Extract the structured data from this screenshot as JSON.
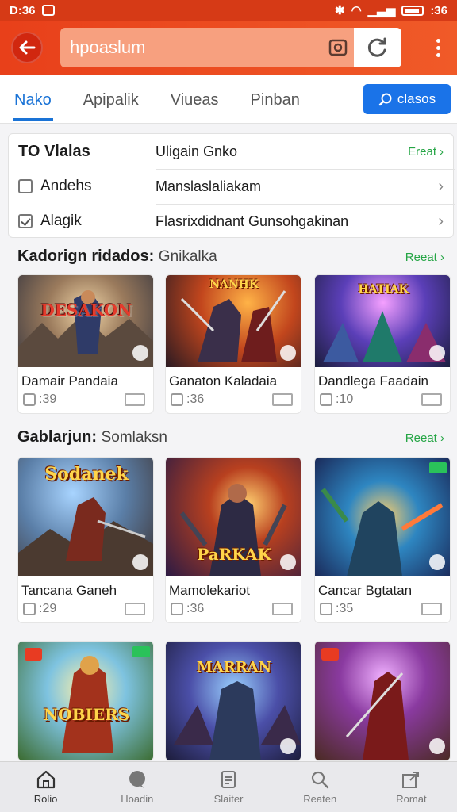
{
  "status": {
    "time": "D:36",
    "right_time": ":36"
  },
  "search": {
    "placeholder": "hpoaslum"
  },
  "tabs": [
    {
      "label": "Nako",
      "active": true
    },
    {
      "label": "Apipalik"
    },
    {
      "label": "Viueas"
    },
    {
      "label": "Pinban"
    }
  ],
  "tab_action": {
    "label": "clasos"
  },
  "filters": {
    "title": "TO Vlalas",
    "header_value": "Uligain Gnko",
    "header_link": "Ereat",
    "rows": [
      {
        "label": "Andehs",
        "value": "Manslaslaliakam",
        "checked": false
      },
      {
        "label": "Alagik",
        "value": "Flasrixdidnant Gunsohgakinan",
        "checked": true
      }
    ]
  },
  "section1": {
    "title": "Kadorign ridados:",
    "subtitle": "Gnikalka",
    "see_all": "Reeat",
    "cards": [
      {
        "name": "Damair Pandaia",
        "rating": ":39",
        "art_title": "DESAKON"
      },
      {
        "name": "Ganaton Kaladaia",
        "rating": ":36",
        "art_title": "NANHK"
      },
      {
        "name": "Dandlega Faadain",
        "rating": ":10",
        "art_title": "HATIAK"
      }
    ]
  },
  "section2": {
    "title": "Gablarjun:",
    "subtitle": "Somlaksn",
    "see_all": "Reeat",
    "cards": [
      {
        "name": "Tancana Ganeh",
        "rating": ":29",
        "art_title": "Sodanek"
      },
      {
        "name": "Mamolekariot",
        "rating": ":36",
        "art_title": "PaRKAK"
      },
      {
        "name": "Cancar Bgtatan",
        "rating": ":35",
        "art_title": ""
      }
    ]
  },
  "section3": {
    "cards": [
      {
        "art_title": "NOBIERS"
      },
      {
        "art_title": "MARRAN"
      },
      {
        "art_title": ""
      }
    ]
  },
  "bottom_nav": [
    {
      "label": "Rolio",
      "icon": "home-icon",
      "active": true
    },
    {
      "label": "Hoadin",
      "icon": "chat-icon"
    },
    {
      "label": "Slaiter",
      "icon": "list-icon"
    },
    {
      "label": "Reaten",
      "icon": "search-icon"
    },
    {
      "label": "Romat",
      "icon": "share-icon"
    }
  ],
  "colors": {
    "brand": "#e8401a",
    "accent_blue": "#1a73e8",
    "link_green": "#25a545"
  }
}
